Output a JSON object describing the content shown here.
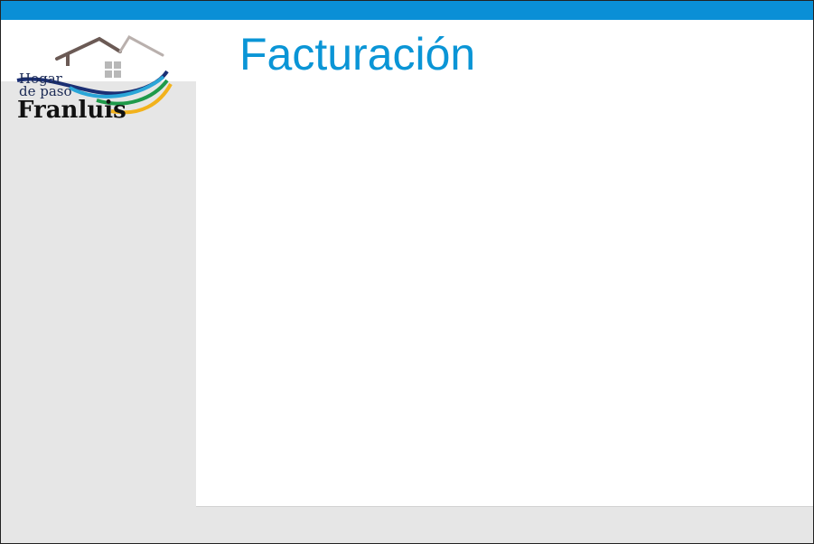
{
  "header": {
    "title": "Facturación",
    "bar_color": "#0a8fd6"
  },
  "logo": {
    "line1": "Hogar",
    "line2": "de paso",
    "line3": "Franluis",
    "icon": "house-roof-logo-icon"
  },
  "colors": {
    "title": "#0a95d6",
    "sidebar": "#e6e6e6",
    "footer": "#e6e6e6"
  }
}
